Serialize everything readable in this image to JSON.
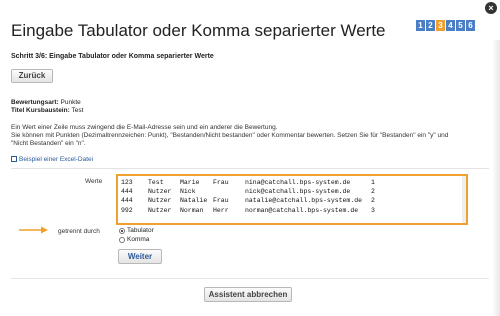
{
  "dialog": {
    "title": "Eingabe Tabulator oder Komma separierter Werte",
    "close_glyph": "×",
    "steps": [
      "1",
      "2",
      "3",
      "4",
      "5",
      "6"
    ],
    "active_step": "3",
    "step_label": "Schritt 3/6: Eingabe Tabulator oder Komma separierter Werte"
  },
  "buttons": {
    "back": "Zurück",
    "next": "Weiter",
    "cancel": "Assistent abbrechen"
  },
  "meta": {
    "rating_type_label": "Bewertungsart:",
    "rating_type_value": "Punkte",
    "course_title_label": "Titel Kursbaustein:",
    "course_title_value": "Test"
  },
  "info": {
    "line1": "Ein Wert einer Zeile muss zwingend die E-Mail-Adresse sein und ein anderer die Bewertung.",
    "line2": "Sie können mit Punkten (Dezimaltrennzeichen: Punkt), \"Bestanden/Nicht bestanden\" oder Kommentar bewerten. Setzen Sie für \"Bestanden\" ein \"y\" und",
    "line3": "\"Nicht Bestanden\" ein \"n\"."
  },
  "example_link": "Beispiel einer Excel-Datei",
  "form": {
    "values_label": "Werte",
    "separator_label": "getrennt durch",
    "rows": [
      [
        "123",
        "Test",
        "Marie",
        "Frau",
        "nina@catchall.bps-system.de",
        "1"
      ],
      [
        "444",
        "Nutzer",
        "Nick",
        "",
        "nick@catchall.bps-system.de",
        "2"
      ],
      [
        "444",
        "Nutzer",
        "Natalie",
        "Frau",
        "natalie@catchall.bps-system.de",
        "2"
      ],
      [
        "992",
        "Nutzer",
        "Norman",
        "Herr",
        "norman@catchall.bps-system.de",
        "3"
      ]
    ],
    "separator_options": [
      "Tabulator",
      "Komma"
    ],
    "separator_selected": "Tabulator"
  },
  "colors": {
    "accent": "#f0a030",
    "step_blue": "#4a7fc8",
    "link": "#2a5a9a"
  },
  "icons": {
    "close": "close-icon",
    "arrow": "arrow-right-icon",
    "link": "external-link-icon"
  }
}
